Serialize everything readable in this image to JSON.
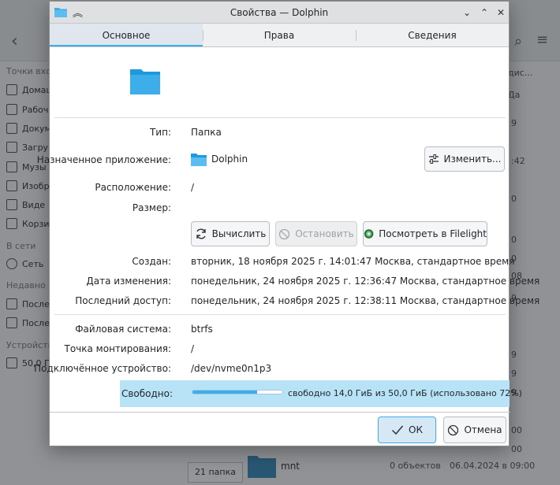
{
  "window": {
    "title": "Свойства — Dolphin",
    "minimize": "⌄",
    "maximize": "⌃",
    "close": "✕",
    "pin": "⌃⌃"
  },
  "tabs": [
    {
      "label": "Основное",
      "active": true
    },
    {
      "label": "Права",
      "active": false
    },
    {
      "label": "Сведения",
      "active": false
    }
  ],
  "general": {
    "type_label": "Тип:",
    "type_value": "Папка",
    "app_label": "Назначенное приложение:",
    "app_value": "Dolphin",
    "change_button": "Изменить...",
    "location_label": "Расположение:",
    "location_value": "/",
    "size_label": "Размер:",
    "calc_button": "Вычислить",
    "stop_button": "Остановить",
    "filelight_button": "Посмотреть в Filelight",
    "created_label": "Создан:",
    "created_value": "вторник, 18 ноября 2025 г. 14:01:47 Москва, стандартное время",
    "modified_label": "Дата изменения:",
    "modified_value": "понедельник, 24 ноября 2025 г. 12:36:47 Москва, стандартное время",
    "accessed_label": "Последний доступ:",
    "accessed_value": "понедельник, 24 ноября 2025 г. 12:38:11 Москва, стандартное время",
    "fs_label": "Файловая система:",
    "fs_value": "btrfs",
    "mount_label": "Точка монтирования:",
    "mount_value": "/",
    "device_label": "Подключённое устройство:",
    "device_value": "/dev/nvme0n1p3",
    "free_label": "Свободно:",
    "free_value": "свободно 14,0 ГиБ из 50,0 ГиБ (использовано 72%)",
    "used_percent": 72
  },
  "footer": {
    "ok": "ОК",
    "cancel": "Отмена"
  },
  "background": {
    "sidebar": {
      "places_header": "Точки вход",
      "items": [
        "Домаш",
        "Рабоч",
        "Докум",
        "Загру",
        "Музы",
        "Изобр",
        "Виде",
        "Корзи"
      ],
      "network_header": "В сети",
      "network_item": "Сеть",
      "recent_header": "Недавно и",
      "recent_items": [
        "После",
        "После"
      ],
      "devices_header": "Устройств",
      "device_item": "50,0 Г"
    },
    "right_col": {
      "header": "дис...",
      "col2": "Да",
      "cells": [
        "9",
        ":42",
        "0",
        "0",
        "0",
        "08",
        "9",
        "9",
        "9",
        "9",
        "00",
        "00"
      ]
    },
    "bottom": {
      "count": "21 папка",
      "name": "mnt",
      "objects": "0 объектов",
      "date": "06.04.2024 в 09:00"
    }
  },
  "colors": {
    "accent": "#3daee9",
    "highlight": "#b8e3f7",
    "folder": "#3daee9"
  }
}
